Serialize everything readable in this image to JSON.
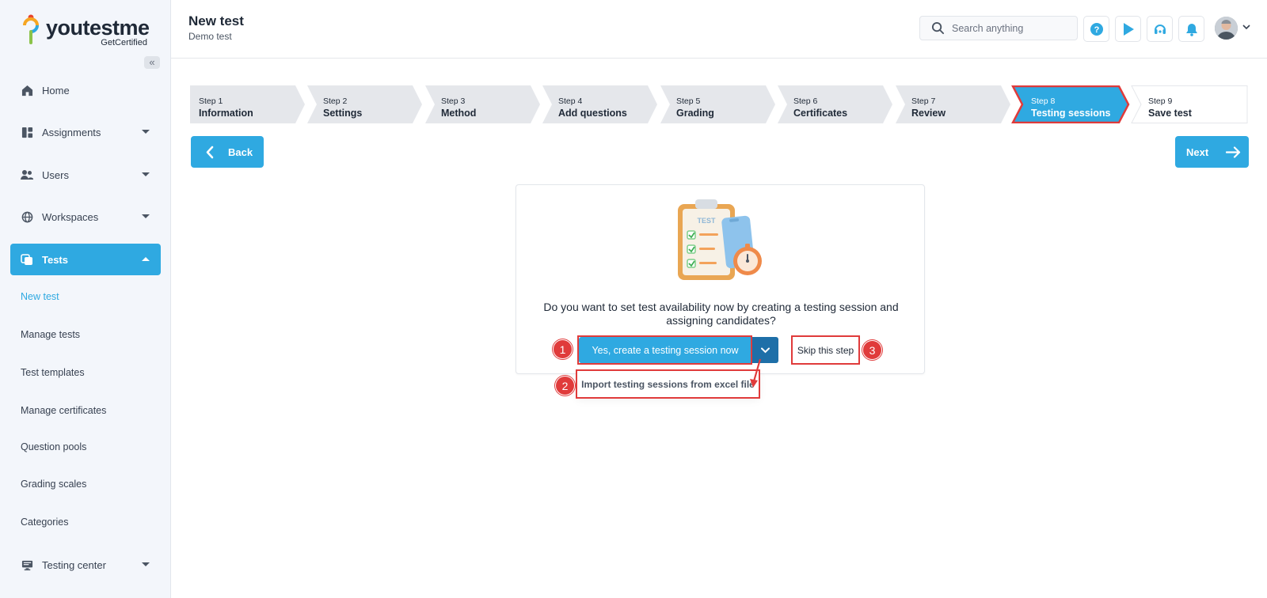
{
  "brand": {
    "name": "youtestme",
    "sub": "GetCertified"
  },
  "sidebar": {
    "collapse_glyph": "«",
    "items": [
      {
        "label": "Home",
        "icon": "home-icon"
      },
      {
        "label": "Assignments",
        "icon": "dashboard-icon"
      },
      {
        "label": "Users",
        "icon": "users-icon"
      },
      {
        "label": "Workspaces",
        "icon": "globe-icon"
      },
      {
        "label": "Tests",
        "icon": "tests-icon"
      },
      {
        "label": "Testing center",
        "icon": "monitor-icon"
      }
    ],
    "sub_items": [
      "New test",
      "Manage tests",
      "Test templates",
      "Manage certificates",
      "Question pools",
      "Grading scales",
      "Categories"
    ]
  },
  "header": {
    "title": "New test",
    "subtitle": "Demo test",
    "search_placeholder": "Search anything"
  },
  "stepper": {
    "steps": [
      {
        "num": "Step 1",
        "label": "Information"
      },
      {
        "num": "Step 2",
        "label": "Settings"
      },
      {
        "num": "Step 3",
        "label": "Method"
      },
      {
        "num": "Step 4",
        "label": "Add questions"
      },
      {
        "num": "Step 5",
        "label": "Grading"
      },
      {
        "num": "Step 6",
        "label": "Certificates"
      },
      {
        "num": "Step 7",
        "label": "Review"
      },
      {
        "num": "Step 8",
        "label": "Testing sessions"
      },
      {
        "num": "Step 9",
        "label": "Save test"
      }
    ],
    "active_index": 7
  },
  "nav": {
    "back_label": "Back",
    "next_label": "Next"
  },
  "dialog": {
    "question": "Do you want to set test availability now by creating a testing session and assigning candidates?",
    "yes_label": "Yes, create a testing session now",
    "skip_label": "Skip this step",
    "import_label": "Import testing sessions from excel file",
    "illustration_text": "TEST"
  },
  "annotations": {
    "m1": "1",
    "m2": "2",
    "m3": "3"
  },
  "colors": {
    "accent": "#2fa9e1",
    "accent_dark": "#1e6fa8",
    "highlight": "#e03b3b",
    "step_bg": "#e5e7eb"
  }
}
